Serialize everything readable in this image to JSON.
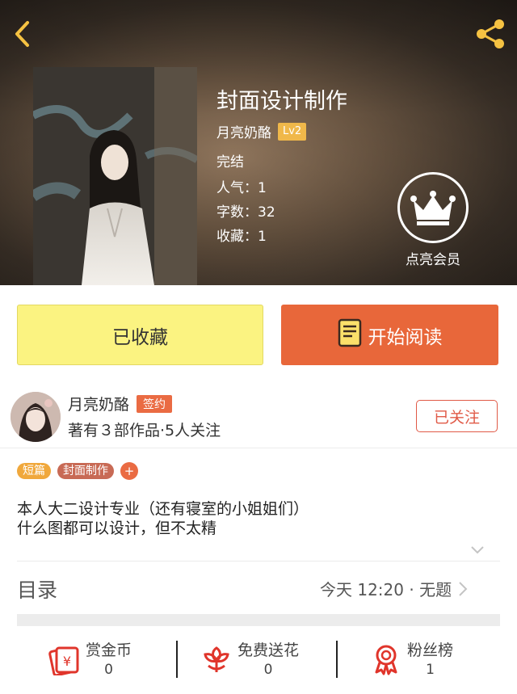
{
  "header": {
    "back_icon": "chevron-left-icon",
    "share_icon": "share-icon",
    "book_title": "封面设计制作",
    "author_name": "月亮奶酪",
    "author_level": "Lv2",
    "status": "完结",
    "popularity": "人气：1",
    "word_count": "字数：32",
    "favorites": "收藏：1",
    "vip_icon": "crown-icon",
    "vip_label": "点亮会员"
  },
  "actions": {
    "collected_label": "已收藏",
    "read_label": "开始阅读",
    "read_icon": "book-icon"
  },
  "author_card": {
    "name": "月亮奶酪",
    "badge": "签约",
    "stats": "著有３部作品·5人关注",
    "follow_label": "已关注"
  },
  "tags": {
    "short": "短篇",
    "category": "封面制作",
    "add": "+"
  },
  "description": {
    "line1": "本人大二设计专业（还有寝室的小姐姐们）",
    "line2": "什么图都可以设计，但不太精"
  },
  "catalog": {
    "title": "目录",
    "latest": "今天 12:20 · 无题"
  },
  "footer": {
    "reward": {
      "label": "赏金币",
      "count": "0",
      "icon": "red-envelope-icon"
    },
    "flowers": {
      "label": "免费送花",
      "count": "0",
      "icon": "flower-icon"
    },
    "fans": {
      "label": "粉丝榜",
      "count": "1",
      "icon": "award-icon"
    }
  },
  "colors": {
    "accent_orange": "#e8673a",
    "collected_yellow": "#fbf381",
    "tag_yellow": "#f0a83c",
    "tag_brown": "#c86a55",
    "level_badge": "#f0b84a",
    "icon_red": "#e0352b",
    "back_arrow_yellow": "#f5c242"
  }
}
